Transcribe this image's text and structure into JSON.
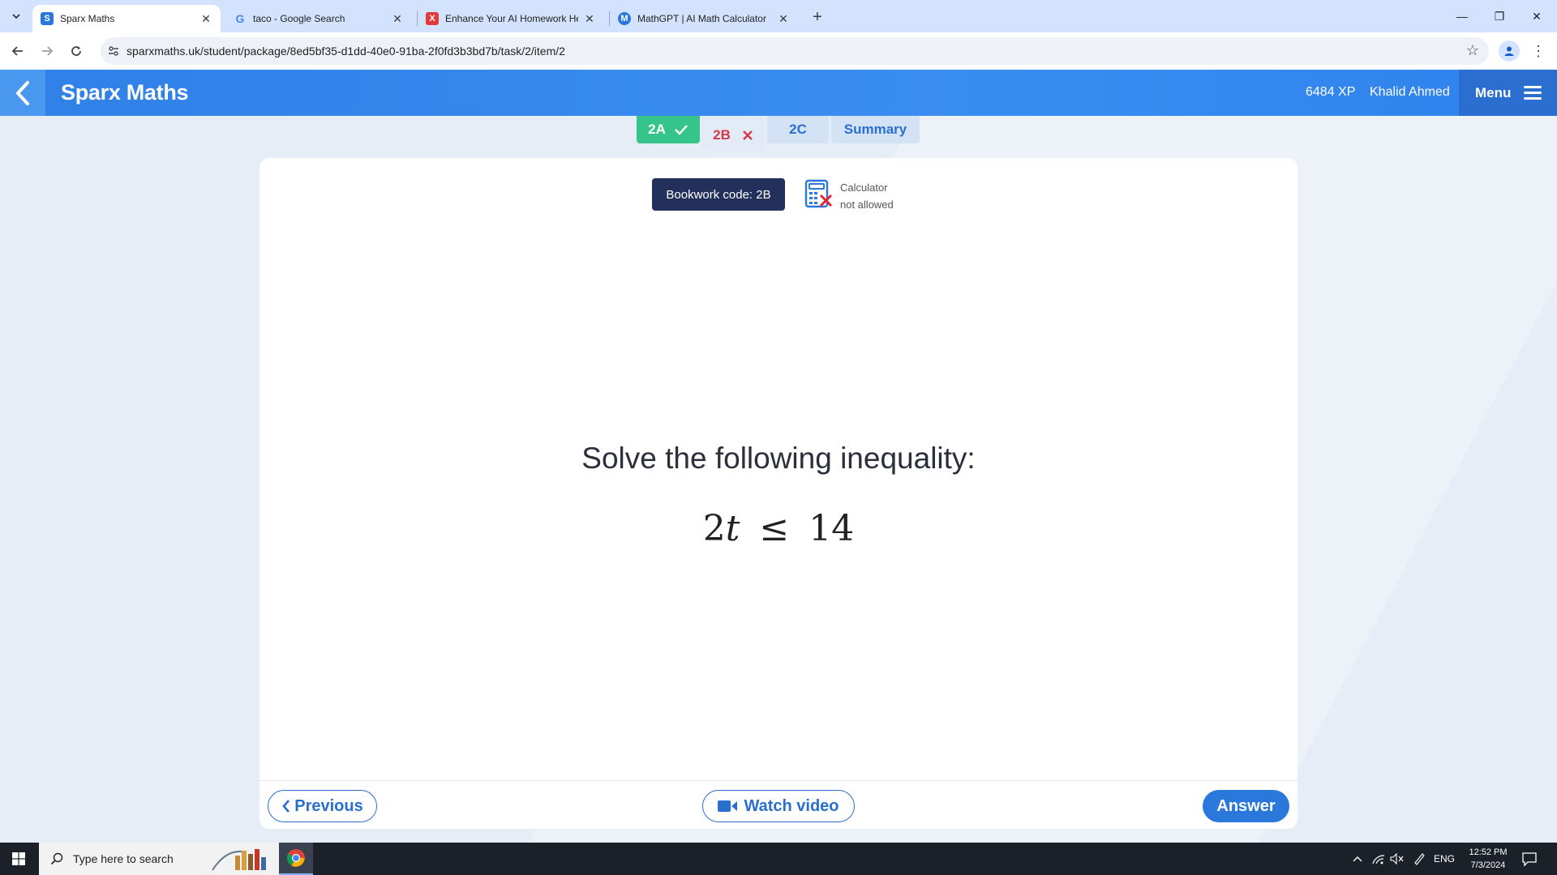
{
  "browser": {
    "tabs": [
      {
        "title": "Sparx Maths",
        "favicon": "S",
        "favicon_color": "#2a78dc",
        "active": true
      },
      {
        "title": "taco - Google Search",
        "favicon": "G",
        "favicon_color": "#ffffff",
        "active": false
      },
      {
        "title": "Enhance Your AI Homework He",
        "favicon": "X",
        "favicon_color": "#e23a3a",
        "active": false
      },
      {
        "title": "MathGPT | AI Math Calculator",
        "favicon": "M",
        "favicon_color": "#2a78dc",
        "active": false
      }
    ],
    "url": "sparxmaths.uk/student/package/8ed5bf35-d1dd-40e0-91ba-2f0fd3b3bd7b/task/2/item/2"
  },
  "header": {
    "brand": "Sparx Maths",
    "xp": "6484 XP",
    "user": "Khalid Ahmed",
    "menu_label": "Menu"
  },
  "task_tabs": [
    {
      "label": "2A",
      "status": "correct",
      "icon": "check-icon"
    },
    {
      "label": "2B",
      "status": "incorrect",
      "icon": "cross-icon"
    },
    {
      "label": "2C",
      "status": "pending"
    },
    {
      "label": "Summary",
      "status": "pending"
    }
  ],
  "question": {
    "bookwork_code": "Bookwork code: 2B",
    "calculator_line1": "Calculator",
    "calculator_line2": "not allowed",
    "prompt": "Solve the following inequality:",
    "equation": {
      "lhs_coef": "2",
      "variable": "t",
      "relation": "≤",
      "rhs": "14"
    }
  },
  "actions": {
    "previous": "Previous",
    "watch_video": "Watch video",
    "answer": "Answer"
  },
  "taskbar": {
    "search_placeholder": "Type here to search",
    "language": "ENG",
    "time": "12:52 PM",
    "date": "7/3/2024"
  },
  "colors": {
    "brand_blue": "#2f80e8",
    "correct_green": "#35c48a",
    "incorrect_red": "#d43a4a",
    "bookwork_navy": "#23305c"
  }
}
